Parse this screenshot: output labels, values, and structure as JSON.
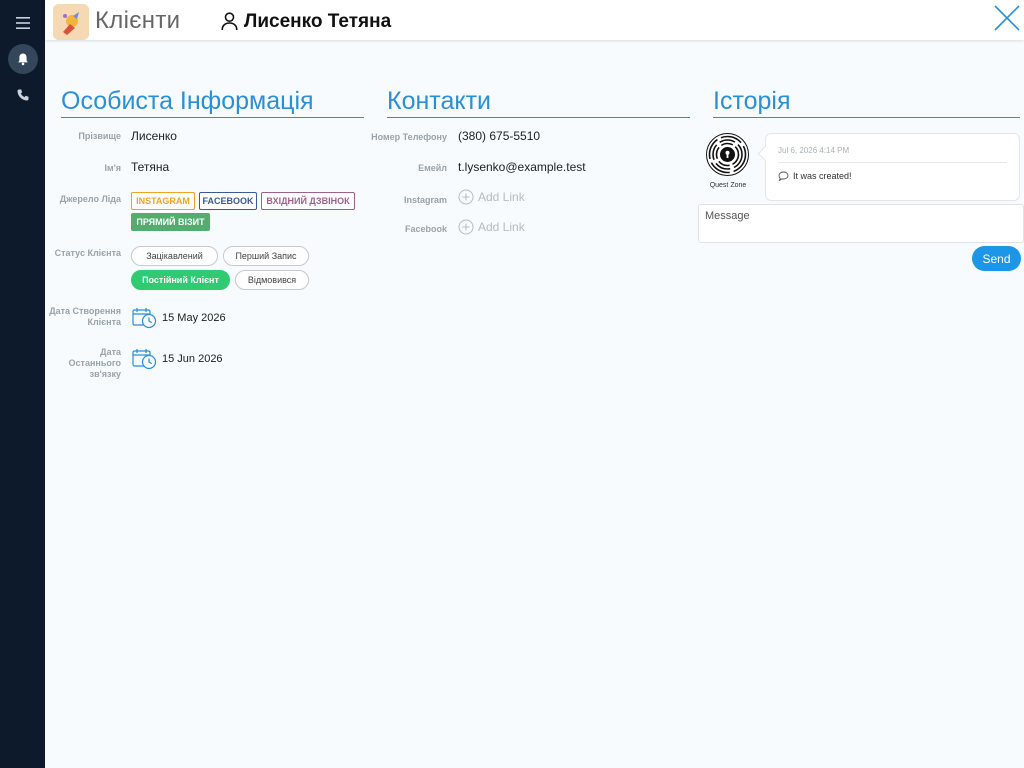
{
  "app": {
    "title": "Клієнти",
    "icons": {
      "menu": "hamburger-icon",
      "notifications": "bell-icon",
      "calls": "phone-icon",
      "client": "person-icon",
      "close": "close-icon"
    }
  },
  "client": {
    "name": "Лисенко Тетяна"
  },
  "sections": {
    "personal": "Особиста Інформація",
    "contacts": "Контакти",
    "history": "Історія"
  },
  "personal": {
    "surname": {
      "label": "Прізвище",
      "value": "Лисенко"
    },
    "first_name": {
      "label": "Ім'я",
      "value": "Тетяна"
    },
    "lead_source": {
      "label": "Джерело Ліда",
      "tags": [
        {
          "label": "Instagram",
          "color": "#f0a224"
        },
        {
          "label": "Facebook",
          "color": "#3b5998"
        },
        {
          "label": "Вхідний дзвінок",
          "color": "#a0608f"
        },
        {
          "label": "Прямий візит",
          "color": "#53ad6f",
          "selected": true
        }
      ]
    },
    "status": {
      "label": "Статус Клієнта",
      "options": [
        {
          "label": "Зацікавлений",
          "selected": false
        },
        {
          "label": "Перший Запис",
          "selected": false
        },
        {
          "label": "Постійний Клієнт",
          "selected": true
        },
        {
          "label": "Відмовився",
          "selected": false
        }
      ]
    },
    "created": {
      "label_line1": "Дата Створення",
      "label_line2": "Клієнта",
      "value": "15 May 2026"
    },
    "last_contact": {
      "label_line1": "Дата Останнього",
      "label_line2": "зв'язку",
      "value": "15 Jun 2026"
    }
  },
  "contacts": {
    "phone": {
      "label": "Номер Телефону",
      "value": "(380) 675-5510"
    },
    "email": {
      "label": "Емейл",
      "value": "t.lysenko@example.test"
    },
    "instagram": {
      "label": "Instagram",
      "action": "Add Link"
    },
    "facebook": {
      "label": "Facebook",
      "action": "Add Link"
    }
  },
  "history": {
    "author": "Quest Zone",
    "events": [
      {
        "date": "Jul 6, 2026 4:14 PM",
        "text": "It was created!"
      }
    ],
    "message_placeholder": "Message",
    "send_label": "Send"
  },
  "colors": {
    "accent": "#2a8fd6",
    "status_active": "#2ecb72",
    "sidebar": "#0c1a2b",
    "send_button": "#1e96e8"
  }
}
